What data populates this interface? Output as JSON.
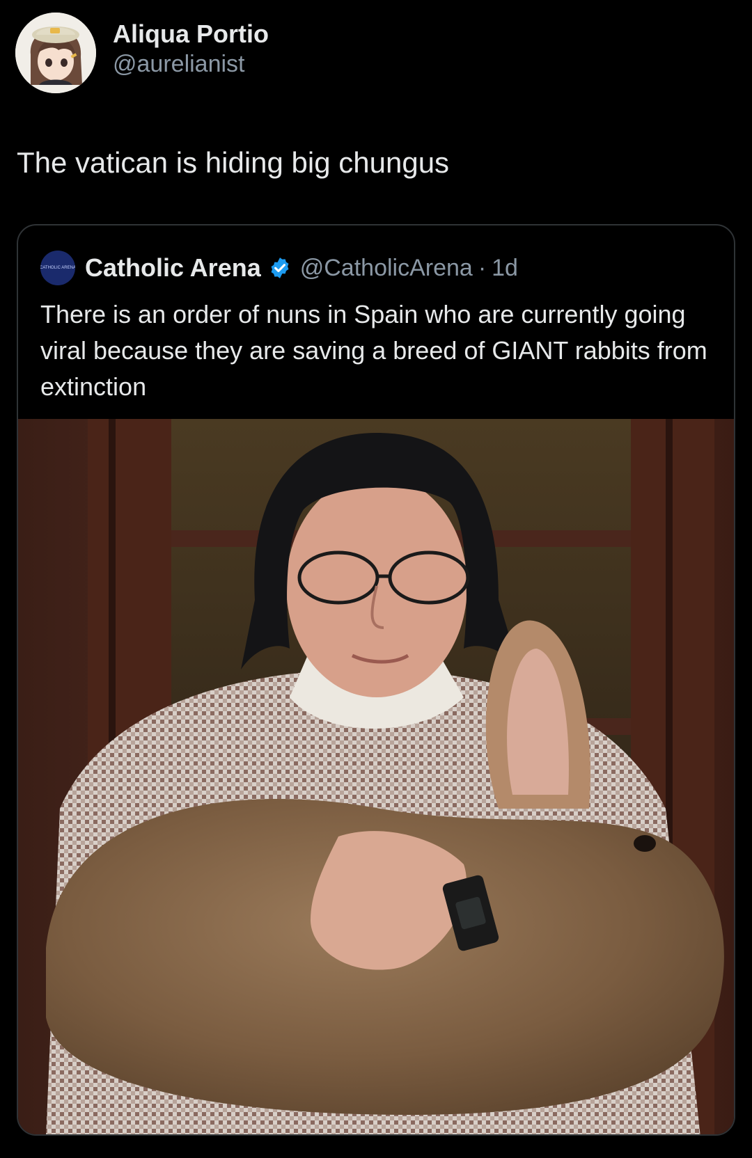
{
  "tweet": {
    "display_name": "Aliqua Portio",
    "handle": "@aurelianist",
    "text": "The vatican is hiding big chungus"
  },
  "quoted_tweet": {
    "avatar_text": "CATHOLIC ARENA",
    "display_name": "Catholic Arena",
    "handle": "@CatholicArena",
    "separator": "·",
    "time": "1d",
    "text": "There is an order of nuns in Spain who are currently going viral because they are saving a breed of GIANT rabbits from extinction"
  },
  "colors": {
    "background": "#000000",
    "text_primary": "#e7e9ea",
    "text_secondary": "#8b98a5",
    "verified_blue": "#1d9bf0",
    "border": "#2f3336"
  },
  "icons": {
    "verified": "verified-badge-icon"
  }
}
